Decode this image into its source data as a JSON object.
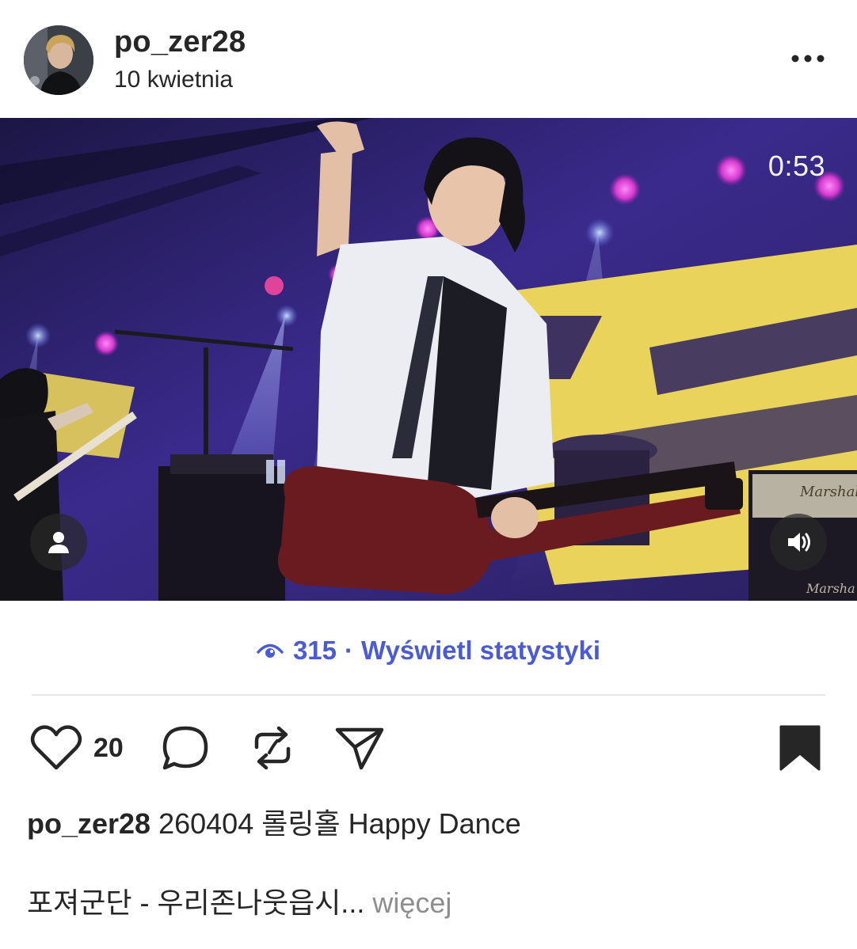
{
  "post": {
    "username": "po_zer28",
    "date": "10 kwietnia",
    "more_icon": "more-horizontal-icon"
  },
  "video": {
    "timer": "0:53",
    "tag_icon": "user-tag-icon",
    "sound_icon": "speaker-icon",
    "stage_text": [
      "Marshall",
      "Marsha"
    ]
  },
  "stats": {
    "views": "315",
    "separator": "·",
    "link_label": "Wyświetl statystyki",
    "icon": "eye-icon",
    "color": "#4a5bd3"
  },
  "actions": {
    "like_icon": "heart-icon",
    "like_count": "20",
    "comment_icon": "comment-icon",
    "repost_icon": "repost-icon",
    "share_icon": "send-icon",
    "save_icon": "bookmark-icon"
  },
  "caption": {
    "username": "po_zer28",
    "line1": "260404 롤링홀 Happy Dance",
    "line2": "포져군단 - 우리존나웃읍시...",
    "more_label": "więcej"
  }
}
